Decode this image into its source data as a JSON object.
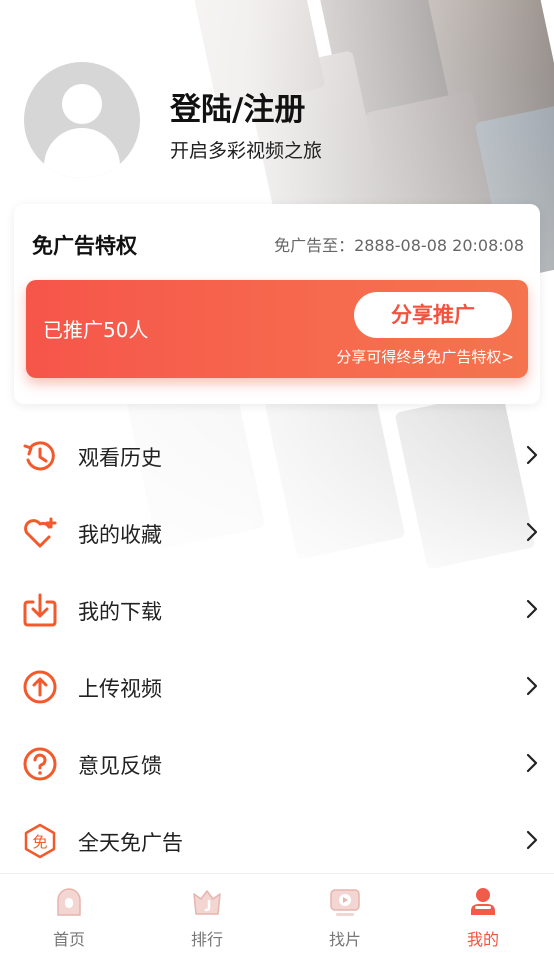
{
  "profile": {
    "login_title": "登陆/注册",
    "subtitle": "开启多彩视频之旅",
    "avatar_icon": "user-avatar-icon"
  },
  "ad_free_card": {
    "title": "免广告特权",
    "expire_text": "免广告至：2888-08-08 20:08:08",
    "promo_count": "已推广50人",
    "share_button": "分享推广",
    "hint": "分享可得终身免广告特权>"
  },
  "menu": {
    "items": [
      {
        "label": "观看历史",
        "icon": "history-icon"
      },
      {
        "label": "我的收藏",
        "icon": "favorite-heart-icon"
      },
      {
        "label": "我的下载",
        "icon": "download-icon"
      },
      {
        "label": "上传视频",
        "icon": "upload-icon"
      },
      {
        "label": "意见反馈",
        "icon": "feedback-question-icon"
      },
      {
        "label": "全天免广告",
        "icon": "ad-free-badge-icon"
      }
    ]
  },
  "tabbar": {
    "tabs": [
      {
        "label": "首页",
        "icon": "home-icon"
      },
      {
        "label": "排行",
        "icon": "ranking-crown-icon"
      },
      {
        "label": "找片",
        "icon": "find-video-icon"
      },
      {
        "label": "我的",
        "icon": "profile-icon",
        "active": true
      }
    ]
  },
  "colors": {
    "accent": "#f4523f",
    "promo_gradient_start": "#f6554a",
    "promo_gradient_end": "#f4744e",
    "icon_orange": "#f25a2c",
    "tab_inactive": "#777777"
  }
}
